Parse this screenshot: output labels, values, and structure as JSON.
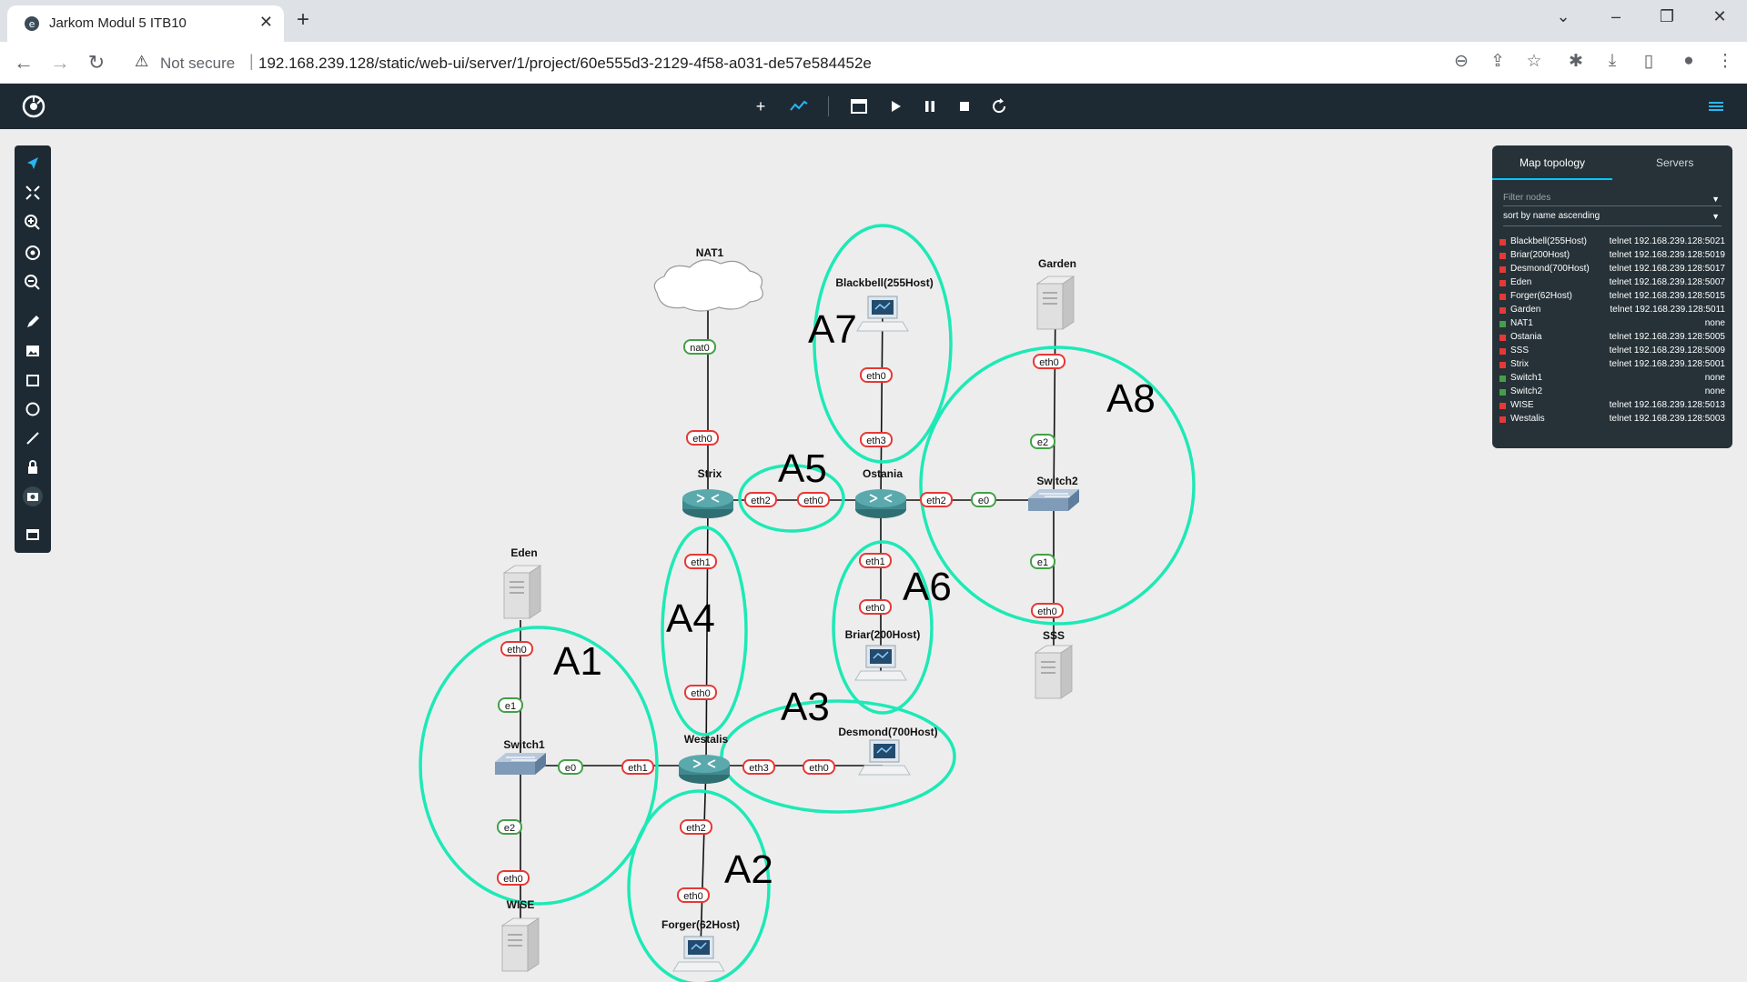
{
  "browser": {
    "tab_title": "Jarkom Modul 5 ITB10",
    "security": "Not secure",
    "url": "192.168.239.128/static/web-ui/server/1/project/60e555d3-2129-4f58-a031-de57e584452e"
  },
  "panel": {
    "tab_map": "Map topology",
    "tab_servers": "Servers",
    "filter_placeholder": "Filter nodes",
    "sort_label": "sort by name ascending",
    "nodes": [
      {
        "name": "Blackbell(255Host)",
        "console": "telnet 192.168.239.128:5021",
        "status": "stopped"
      },
      {
        "name": "Briar(200Host)",
        "console": "telnet 192.168.239.128:5019",
        "status": "stopped"
      },
      {
        "name": "Desmond(700Host)",
        "console": "telnet 192.168.239.128:5017",
        "status": "stopped"
      },
      {
        "name": "Eden",
        "console": "telnet 192.168.239.128:5007",
        "status": "stopped"
      },
      {
        "name": "Forger(62Host)",
        "console": "telnet 192.168.239.128:5015",
        "status": "stopped"
      },
      {
        "name": "Garden",
        "console": "telnet 192.168.239.128:5011",
        "status": "stopped"
      },
      {
        "name": "NAT1",
        "console": "none",
        "status": "started"
      },
      {
        "name": "Ostania",
        "console": "telnet 192.168.239.128:5005",
        "status": "stopped"
      },
      {
        "name": "SSS",
        "console": "telnet 192.168.239.128:5009",
        "status": "stopped"
      },
      {
        "name": "Strix",
        "console": "telnet 192.168.239.128:5001",
        "status": "stopped"
      },
      {
        "name": "Switch1",
        "console": "none",
        "status": "started"
      },
      {
        "name": "Switch2",
        "console": "none",
        "status": "started"
      },
      {
        "name": "WISE",
        "console": "telnet 192.168.239.128:5013",
        "status": "stopped"
      },
      {
        "name": "Westalis",
        "console": "telnet 192.168.239.128:5003",
        "status": "stopped"
      }
    ]
  },
  "topology": {
    "nodes": {
      "nat1": "NAT1",
      "strix": "Strix",
      "ostania": "Ostania",
      "westalis": "Westalis",
      "switch1": "Switch1",
      "switch2": "Switch2",
      "blackbell": "Blackbell(255Host)",
      "garden": "Garden",
      "eden": "Eden",
      "sss": "SSS",
      "briar": "Briar(200Host)",
      "desmond": "Desmond(700Host)",
      "forger": "Forger(62Host)",
      "wise": "WISE"
    },
    "ports": {
      "nat0": "nat0",
      "eth0": "eth0",
      "eth1": "eth1",
      "eth2": "eth2",
      "eth3": "eth3",
      "e0": "e0",
      "e1": "e1",
      "e2": "e2"
    },
    "areas": [
      "A1",
      "A2",
      "A3",
      "A4",
      "A5",
      "A6",
      "A7",
      "A8"
    ]
  },
  "colors": {
    "stopped": "#e53935",
    "started": "#43a047",
    "area_outline": "#1de9b6",
    "toolbar_bg": "#1e2a33",
    "panel_bg": "#263238"
  }
}
